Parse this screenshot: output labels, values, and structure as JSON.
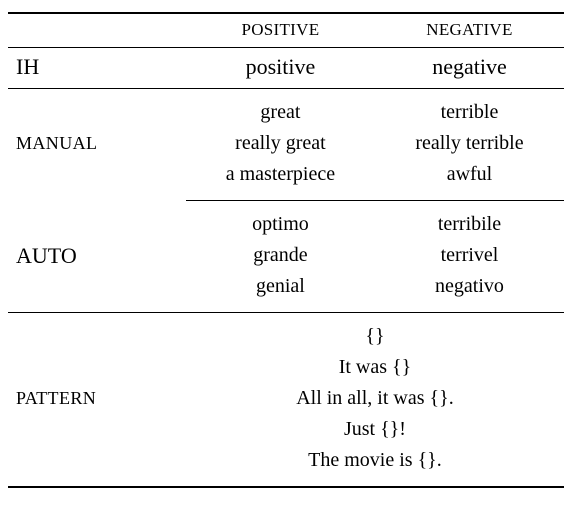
{
  "headers": {
    "positive": "POSITIVE",
    "negative": "NEGATIVE"
  },
  "rows": {
    "ih": {
      "label": "IH",
      "positive": "positive",
      "negative": "negative"
    },
    "manual": {
      "label": "MANUAL",
      "positive": [
        "great",
        "really great",
        "a masterpiece"
      ],
      "negative": [
        "terrible",
        "really terrible",
        "awful"
      ]
    },
    "auto": {
      "label": "AUTO",
      "positive": [
        "optimo",
        "grande",
        "genial"
      ],
      "negative": [
        "terribile",
        "terrivel",
        "negativo"
      ]
    },
    "pattern": {
      "label": "PATTERN",
      "items": [
        "{}",
        "It was {}",
        "All in all, it was {}.",
        "Just {}!",
        "The movie is {}."
      ]
    }
  }
}
